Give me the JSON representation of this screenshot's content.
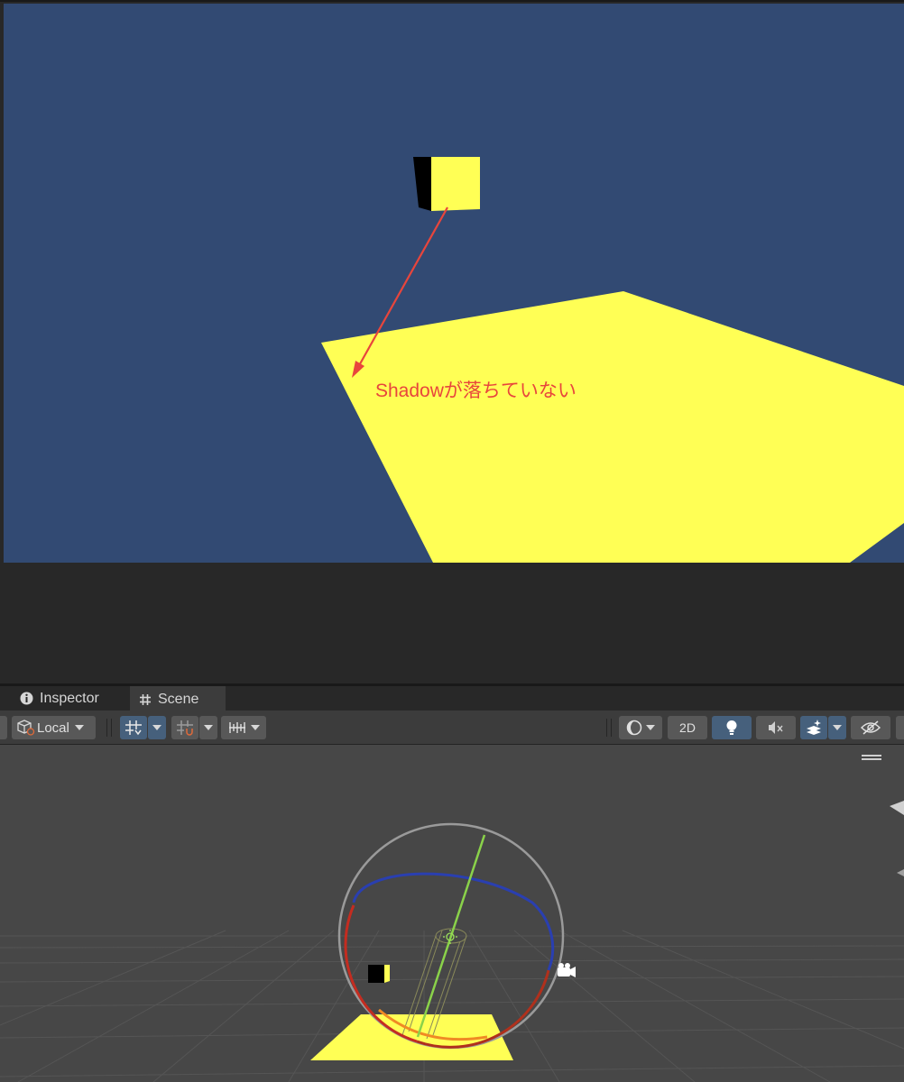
{
  "game_view": {
    "annotation": "Shadowが落ちていない",
    "colors": {
      "sky": "#324a73",
      "object_yellow": "#ffff55",
      "cube_side": "#000000",
      "annotation_red": "#e8453c"
    }
  },
  "tabs": [
    {
      "label": "Inspector",
      "icon": "info-icon"
    },
    {
      "label": "Scene",
      "icon": "hash-icon"
    }
  ],
  "toolbar": {
    "pivot_rotation": "Local",
    "mode_2d": "2D",
    "icons": [
      "pivot-cube-icon",
      "grid-snap-icon",
      "increment-snap-icon",
      "ruler-icon",
      "shading-mode-icon",
      "lighting-icon",
      "audio-mute-icon",
      "effects-icon",
      "visibility-icon"
    ]
  },
  "scene_view": {
    "colors": {
      "background": "#474747",
      "x_handle": "#c42c20",
      "y_handle": "#8ad24a",
      "z_handle": "#2a3fb0",
      "highlight": "#f08a24"
    }
  }
}
